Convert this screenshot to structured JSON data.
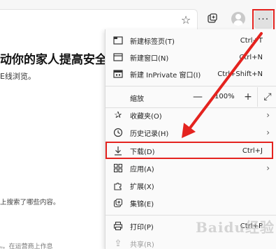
{
  "page": {
    "heading": "动你的家人提高安全性",
    "subtext": "E线浏览。",
    "line2": "上搜索了哪些内容。",
    "line3": "ᵤ。在运营商上作息"
  },
  "toolbar": {
    "star_icon": "star-icon",
    "collections_icon": "collections-icon",
    "more_label": "···"
  },
  "menu": {
    "items": [
      {
        "label": "新建标签页(T)",
        "shortcut": "Ctrl+T",
        "icon": "new-tab-icon"
      },
      {
        "label": "新建窗口(N)",
        "shortcut": "Ctrl+N",
        "icon": "new-window-icon"
      },
      {
        "label": "新建 InPrivate 窗口(I)",
        "shortcut": "Ctrl+Shift+N",
        "icon": "inprivate-icon"
      }
    ],
    "zoom": {
      "label": "缩放",
      "minus": "—",
      "value": "100%",
      "plus": "+",
      "fullscreen": "⤢"
    },
    "items2": [
      {
        "label": "收藏夹(O)",
        "icon": "favorites-icon"
      },
      {
        "label": "历史记录(H)",
        "icon": "history-icon"
      },
      {
        "label": "下载(D)",
        "shortcut": "Ctrl+J",
        "icon": "download-icon"
      },
      {
        "label": "应用(A)",
        "icon": "apps-icon"
      },
      {
        "label": "扩展(X)",
        "icon": "extensions-icon"
      },
      {
        "label": "集锦(E)",
        "icon": "collections-icon"
      },
      {
        "label": "打印(P)",
        "shortcut": "Ctrl+P",
        "icon": "print-icon"
      },
      {
        "label": "共享(R)",
        "icon": "share-icon"
      }
    ],
    "arrow": "›"
  },
  "watermark": "Baidu经验",
  "colors": {
    "highlight": "#e4231f",
    "menu_bg": "#fafafa"
  }
}
